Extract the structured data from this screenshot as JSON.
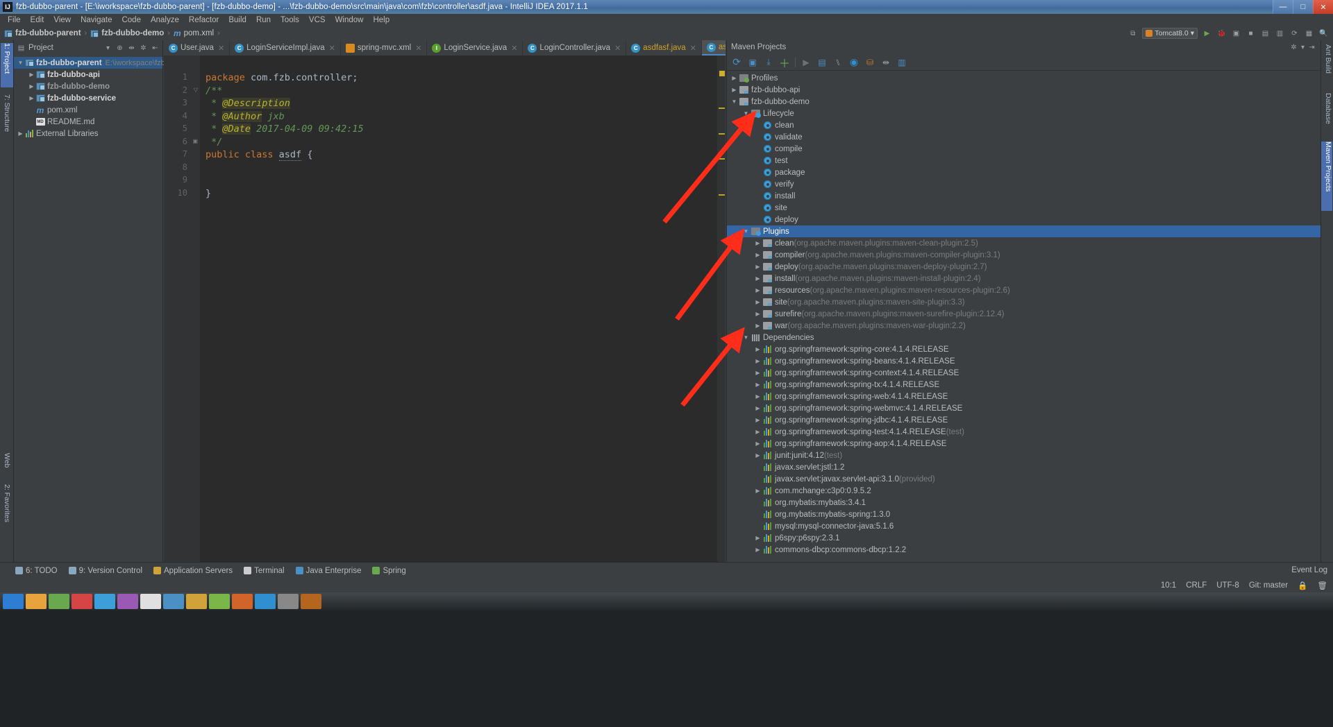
{
  "window": {
    "title": "fzb-dubbo-parent - [E:\\iworkspace\\fzb-dubbo-parent] - [fzb-dubbo-demo] - ...\\fzb-dubbo-demo\\src\\main\\java\\com\\fzb\\controller\\asdf.java - IntelliJ IDEA 2017.1.1",
    "logo": "IJ",
    "minimize": "—",
    "maximize": "□",
    "close": "✕"
  },
  "menu": {
    "items": [
      "File",
      "Edit",
      "View",
      "Navigate",
      "Code",
      "Analyze",
      "Refactor",
      "Build",
      "Run",
      "Tools",
      "VCS",
      "Window",
      "Help"
    ]
  },
  "breadcrumb": {
    "parent": "fzb-dubbo-parent",
    "module": "fzb-dubbo-demo",
    "file": "pom.xml",
    "separator": "›"
  },
  "navright": {
    "run_config": "Tomcat8.0",
    "icons": [
      "run-icon",
      "debug-icon",
      "coverage-icon",
      "profile-icon",
      "build-icon",
      "sync-icon",
      "avd-icon",
      "sdk-icon",
      "search-icon"
    ]
  },
  "left_strip": {
    "tabs": [
      {
        "label": "1: Project",
        "selected": true
      },
      {
        "label": "7: Structure",
        "selected": false
      },
      {
        "label": "Web",
        "selected": false
      },
      {
        "label": "2: Favorites",
        "selected": false
      }
    ]
  },
  "right_strip": {
    "tabs": [
      {
        "label": "Ant Build",
        "selected": false
      },
      {
        "label": "Database",
        "selected": false
      },
      {
        "label": "Maven Projects",
        "selected": true
      }
    ]
  },
  "project_panel": {
    "title": "Project",
    "header_icons": [
      "project-view-icon",
      "chevron-down-icon",
      "locate-icon",
      "collapse-icon",
      "settings-icon",
      "hide-icon"
    ],
    "tree": [
      {
        "depth": 0,
        "arrow": "▼",
        "icon": "module-icon",
        "label": "fzb-dubbo-parent",
        "bold": true,
        "path": "E:\\iworkspace\\fzb",
        "selected": true
      },
      {
        "depth": 1,
        "arrow": "▶",
        "icon": "module-icon",
        "label": "fzb-dubbo-api",
        "bold": true,
        "path": "",
        "selected": false
      },
      {
        "depth": 1,
        "arrow": "▶",
        "icon": "module-icon",
        "label": "fzb-dubbo-demo",
        "bold": true,
        "path": "",
        "selected": false,
        "grey": true
      },
      {
        "depth": 1,
        "arrow": "▶",
        "icon": "module-icon",
        "label": "fzb-dubbo-service",
        "bold": true,
        "path": "",
        "selected": false
      },
      {
        "depth": 1,
        "arrow": "",
        "icon": "maven-xml-icon",
        "label": "pom.xml",
        "bold": false,
        "path": "",
        "selected": false
      },
      {
        "depth": 1,
        "arrow": "",
        "icon": "markdown-icon",
        "label": "README.md",
        "bold": false,
        "path": "",
        "selected": false
      },
      {
        "depth": 0,
        "arrow": "▶",
        "icon": "library-icon",
        "label": "External Libraries",
        "bold": false,
        "path": "",
        "selected": false
      }
    ]
  },
  "editor": {
    "tabs": [
      {
        "label": "User.java",
        "icon": "java-class-icon",
        "kind": "class",
        "active": false,
        "modified": false
      },
      {
        "label": "LoginServiceImpl.java",
        "icon": "java-class-icon",
        "kind": "class",
        "active": false,
        "modified": false
      },
      {
        "label": "spring-mvc.xml",
        "icon": "spring-xml-icon",
        "kind": "xml",
        "active": false,
        "modified": false
      },
      {
        "label": "LoginService.java",
        "icon": "java-interface-icon",
        "kind": "interface",
        "active": false,
        "modified": false
      },
      {
        "label": "LoginController.java",
        "icon": "java-class-icon",
        "kind": "class",
        "active": false,
        "modified": false
      },
      {
        "label": "asdfasf.java",
        "icon": "java-class-icon",
        "kind": "class",
        "active": false,
        "modified": true
      },
      {
        "label": "asdf.java",
        "icon": "java-class-icon",
        "kind": "class",
        "active": true,
        "modified": true
      }
    ],
    "close_glyph": "✕",
    "line_numbers": [
      "1",
      "2",
      "3",
      "4",
      "5",
      "6",
      "7",
      "8",
      "9",
      "10"
    ],
    "code_lines": [
      [
        {
          "t": "package ",
          "c": "kw"
        },
        {
          "t": "com.fzb.controller;",
          "c": "plain"
        }
      ],
      [
        {
          "t": "/**",
          "c": "cmt"
        }
      ],
      [
        {
          "t": " * ",
          "c": "cmt"
        },
        {
          "t": "@Description",
          "c": "tag"
        }
      ],
      [
        {
          "t": " * ",
          "c": "cmt"
        },
        {
          "t": "@Author",
          "c": "tag"
        },
        {
          "t": " jxb",
          "c": "cmt"
        }
      ],
      [
        {
          "t": " * ",
          "c": "cmt"
        },
        {
          "t": "@Date",
          "c": "tag"
        },
        {
          "t": " 2017-04-09 09:42:15",
          "c": "cmt"
        }
      ],
      [
        {
          "t": " */",
          "c": "cmt"
        }
      ],
      [
        {
          "t": "public class ",
          "c": "kw"
        },
        {
          "t": "asdf",
          "c": "cname"
        },
        {
          "t": " {",
          "c": "plain"
        }
      ],
      [],
      [],
      [
        {
          "t": "}",
          "c": "plain"
        }
      ]
    ]
  },
  "maven": {
    "title": "Maven Projects",
    "header_icons": [
      "settings-icon",
      "collapse-icon",
      "hide-icon"
    ],
    "toolbar_icons": [
      "reimport-icon",
      "generate-sources-icon",
      "download-sources-icon",
      "add-maven-project-icon",
      "run-icon",
      "execute-goal-icon",
      "toggle-skip-tests-icon",
      "toggle-offline-icon",
      "show-dependencies-icon",
      "collapse-all-icon",
      "settings-icon"
    ],
    "tree": [
      {
        "depth": 0,
        "arrow": "▶",
        "icon": "profiles-folder-icon",
        "label": "Profiles",
        "selected": false
      },
      {
        "depth": 0,
        "arrow": "▶",
        "icon": "maven-project-icon",
        "label": "fzb-dubbo-api",
        "selected": false
      },
      {
        "depth": 0,
        "arrow": "▼",
        "icon": "maven-project-icon",
        "label": "fzb-dubbo-demo",
        "selected": false
      },
      {
        "depth": 1,
        "arrow": "▼",
        "icon": "lifecycle-folder-icon",
        "label": "Lifecycle",
        "selected": false
      },
      {
        "depth": 2,
        "arrow": "",
        "icon": "goal-icon",
        "label": "clean",
        "selected": false
      },
      {
        "depth": 2,
        "arrow": "",
        "icon": "goal-icon",
        "label": "validate",
        "selected": false
      },
      {
        "depth": 2,
        "arrow": "",
        "icon": "goal-icon",
        "label": "compile",
        "selected": false
      },
      {
        "depth": 2,
        "arrow": "",
        "icon": "goal-icon",
        "label": "test",
        "selected": false
      },
      {
        "depth": 2,
        "arrow": "",
        "icon": "goal-icon",
        "label": "package",
        "selected": false
      },
      {
        "depth": 2,
        "arrow": "",
        "icon": "goal-icon",
        "label": "verify",
        "selected": false
      },
      {
        "depth": 2,
        "arrow": "",
        "icon": "goal-icon",
        "label": "install",
        "selected": false
      },
      {
        "depth": 2,
        "arrow": "",
        "icon": "goal-icon",
        "label": "site",
        "selected": false
      },
      {
        "depth": 2,
        "arrow": "",
        "icon": "goal-icon",
        "label": "deploy",
        "selected": false
      },
      {
        "depth": 1,
        "arrow": "▼",
        "icon": "plugins-folder-icon",
        "label": "Plugins",
        "selected": true
      },
      {
        "depth": 2,
        "arrow": "▶",
        "icon": "plugin-icon",
        "label": "clean",
        "coord": " (org.apache.maven.plugins:maven-clean-plugin:2.5)",
        "selected": false
      },
      {
        "depth": 2,
        "arrow": "▶",
        "icon": "plugin-icon",
        "label": "compiler",
        "coord": " (org.apache.maven.plugins:maven-compiler-plugin:3.1)",
        "selected": false
      },
      {
        "depth": 2,
        "arrow": "▶",
        "icon": "plugin-icon",
        "label": "deploy",
        "coord": " (org.apache.maven.plugins:maven-deploy-plugin:2.7)",
        "selected": false
      },
      {
        "depth": 2,
        "arrow": "▶",
        "icon": "plugin-icon",
        "label": "install",
        "coord": " (org.apache.maven.plugins:maven-install-plugin:2.4)",
        "selected": false
      },
      {
        "depth": 2,
        "arrow": "▶",
        "icon": "plugin-icon",
        "label": "resources",
        "coord": " (org.apache.maven.plugins:maven-resources-plugin:2.6)",
        "selected": false
      },
      {
        "depth": 2,
        "arrow": "▶",
        "icon": "plugin-icon",
        "label": "site",
        "coord": " (org.apache.maven.plugins:maven-site-plugin:3.3)",
        "selected": false
      },
      {
        "depth": 2,
        "arrow": "▶",
        "icon": "plugin-icon",
        "label": "surefire",
        "coord": " (org.apache.maven.plugins:maven-surefire-plugin:2.12.4)",
        "selected": false
      },
      {
        "depth": 2,
        "arrow": "▶",
        "icon": "plugin-icon",
        "label": "war",
        "coord": " (org.apache.maven.plugins:maven-war-plugin:2.2)",
        "selected": false
      },
      {
        "depth": 1,
        "arrow": "▼",
        "icon": "dependencies-folder-icon",
        "label": "Dependencies",
        "selected": false
      },
      {
        "depth": 2,
        "arrow": "▶",
        "icon": "jar-icon",
        "label": "org.springframework:spring-core:4.1.4.RELEASE",
        "selected": false
      },
      {
        "depth": 2,
        "arrow": "▶",
        "icon": "jar-icon",
        "label": "org.springframework:spring-beans:4.1.4.RELEASE",
        "selected": false
      },
      {
        "depth": 2,
        "arrow": "▶",
        "icon": "jar-icon",
        "label": "org.springframework:spring-context:4.1.4.RELEASE",
        "selected": false
      },
      {
        "depth": 2,
        "arrow": "▶",
        "icon": "jar-icon",
        "label": "org.springframework:spring-tx:4.1.4.RELEASE",
        "selected": false
      },
      {
        "depth": 2,
        "arrow": "▶",
        "icon": "jar-icon",
        "label": "org.springframework:spring-web:4.1.4.RELEASE",
        "selected": false
      },
      {
        "depth": 2,
        "arrow": "▶",
        "icon": "jar-icon",
        "label": "org.springframework:spring-webmvc:4.1.4.RELEASE",
        "selected": false
      },
      {
        "depth": 2,
        "arrow": "▶",
        "icon": "jar-icon",
        "label": "org.springframework:spring-jdbc:4.1.4.RELEASE",
        "selected": false
      },
      {
        "depth": 2,
        "arrow": "▶",
        "icon": "jar-icon",
        "label": "org.springframework:spring-test:4.1.4.RELEASE",
        "coord": " (test)",
        "selected": false
      },
      {
        "depth": 2,
        "arrow": "▶",
        "icon": "jar-icon",
        "label": "org.springframework:spring-aop:4.1.4.RELEASE",
        "selected": false
      },
      {
        "depth": 2,
        "arrow": "▶",
        "icon": "jar-icon",
        "label": "junit:junit:4.12",
        "coord": " (test)",
        "selected": false
      },
      {
        "depth": 2,
        "arrow": "",
        "icon": "jar-icon",
        "label": "javax.servlet:jstl:1.2",
        "selected": false
      },
      {
        "depth": 2,
        "arrow": "",
        "icon": "jar-icon",
        "label": "javax.servlet:javax.servlet-api:3.1.0",
        "coord": " (provided)",
        "selected": false
      },
      {
        "depth": 2,
        "arrow": "▶",
        "icon": "jar-icon",
        "label": "com.mchange:c3p0:0.9.5.2",
        "selected": false
      },
      {
        "depth": 2,
        "arrow": "",
        "icon": "jar-icon",
        "label": "org.mybatis:mybatis:3.4.1",
        "selected": false
      },
      {
        "depth": 2,
        "arrow": "",
        "icon": "jar-icon",
        "label": "org.mybatis:mybatis-spring:1.3.0",
        "selected": false
      },
      {
        "depth": 2,
        "arrow": "",
        "icon": "jar-icon",
        "label": "mysql:mysql-connector-java:5.1.6",
        "selected": false
      },
      {
        "depth": 2,
        "arrow": "▶",
        "icon": "jar-icon",
        "label": "p6spy:p6spy:2.3.1",
        "selected": false
      },
      {
        "depth": 2,
        "arrow": "▶",
        "icon": "jar-icon",
        "label": "commons-dbcp:commons-dbcp:1.2.2",
        "selected": false
      }
    ]
  },
  "statusbar": {
    "items": [
      {
        "label": "6: TODO",
        "color": "#8aa7c0"
      },
      {
        "label": "9: Version Control",
        "color": "#8aa7c0"
      },
      {
        "label": "Application Servers",
        "color": "#cfa33a"
      },
      {
        "label": "Terminal",
        "color": "#cccccc"
      },
      {
        "label": "Java Enterprise",
        "color": "#4a90c4"
      },
      {
        "label": "Spring",
        "color": "#6aa84f"
      }
    ],
    "event_log": "Event Log",
    "caret": "10:1",
    "line_sep": "CRLF",
    "encoding": "UTF-8",
    "branch": "Git: master"
  },
  "accent": {
    "selection_blue": "#3465a4",
    "arrow_red": "#ff2d1a",
    "tab_active": "#4e5254"
  }
}
